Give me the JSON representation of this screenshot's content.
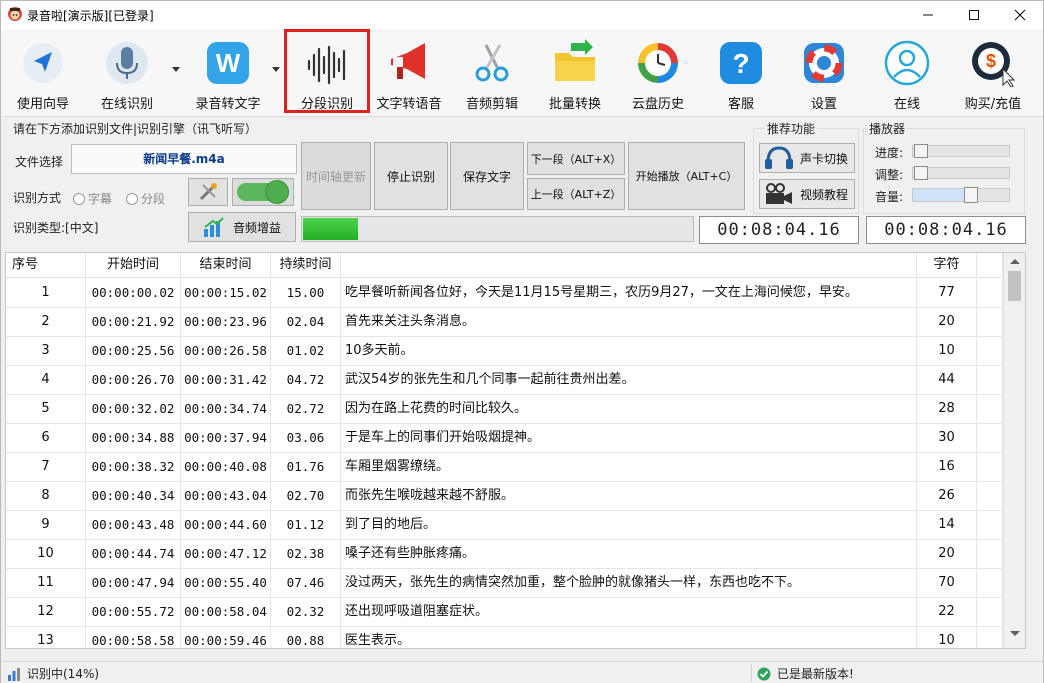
{
  "window": {
    "title": "录音啦[演示版][已登录]"
  },
  "toolbar": {
    "items": [
      {
        "label": "使用向导",
        "icon": "navigation-arrow-icon"
      },
      {
        "label": "在线识别",
        "icon": "microphone-icon"
      },
      {
        "label": "录音转文字",
        "icon": "w-logo-icon"
      },
      {
        "label": "分段识别",
        "icon": "waveform-icon"
      },
      {
        "label": "文字转语音",
        "icon": "megaphone-icon"
      },
      {
        "label": "音频剪辑",
        "icon": "scissors-icon"
      },
      {
        "label": "批量转换",
        "icon": "folder-convert-icon"
      },
      {
        "label": "云盘历史",
        "icon": "history-clock-icon"
      },
      {
        "label": "客服",
        "icon": "help-question-icon"
      },
      {
        "label": "设置",
        "icon": "lifebuoy-icon"
      },
      {
        "label": "在线",
        "icon": "user-online-icon"
      },
      {
        "label": "购买/充值",
        "icon": "dollar-coin-icon"
      }
    ]
  },
  "controls": {
    "group_title": "请在下方添加识别文件|识别引擎（讯飞听写）",
    "file_label": "文件选择",
    "file_name": "新闻早餐.m4a",
    "mode_label": "识别方式",
    "mode_option_subtitle": "字幕",
    "mode_option_segment": "分段",
    "type_label": "识别类型:[中文]",
    "audio_gain": "音频增益",
    "btn_update_timeline": "时间轴更新",
    "btn_stop": "停止识别",
    "btn_save": "保存文字",
    "btn_next": "下一段（ALT+X）",
    "btn_prev": "上一段（ALT+Z）",
    "btn_play": "开始播放（ALT+C）",
    "progress": 0.14,
    "time_current": "00:08:04.16",
    "time_total": "00:08:04.16"
  },
  "recommend": {
    "title": "推荐功能",
    "sound_card": "声卡切换",
    "video_tutorial": "视频教程"
  },
  "player": {
    "title": "播放器",
    "progress_label": "进度:",
    "adjust_label": "调整:",
    "volume_label": "音量:",
    "volume_level": 0.6
  },
  "table": {
    "headers": {
      "no": "序号",
      "start": "开始时间",
      "end": "结束时间",
      "duration": "持续时间",
      "text": "",
      "chars": "字符"
    },
    "rows": [
      {
        "no": "1",
        "start": "00:00:00.02",
        "end": "00:00:15.02",
        "duration": "15.00",
        "text": "吃早餐听新闻各位好，今天是11月15号星期三，农历9月27，一文在上海问候您，早安。",
        "chars": "77"
      },
      {
        "no": "2",
        "start": "00:00:21.92",
        "end": "00:00:23.96",
        "duration": "02.04",
        "text": "首先来关注头条消息。",
        "chars": "20"
      },
      {
        "no": "3",
        "start": "00:00:25.56",
        "end": "00:00:26.58",
        "duration": "01.02",
        "text": "10多天前。",
        "chars": "10"
      },
      {
        "no": "4",
        "start": "00:00:26.70",
        "end": "00:00:31.42",
        "duration": "04.72",
        "text": "武汉54岁的张先生和几个同事一起前往贵州出差。",
        "chars": "44"
      },
      {
        "no": "5",
        "start": "00:00:32.02",
        "end": "00:00:34.74",
        "duration": "02.72",
        "text": "因为在路上花费的时间比较久。",
        "chars": "28"
      },
      {
        "no": "6",
        "start": "00:00:34.88",
        "end": "00:00:37.94",
        "duration": "03.06",
        "text": "于是车上的同事们开始吸烟提神。",
        "chars": "30"
      },
      {
        "no": "7",
        "start": "00:00:38.32",
        "end": "00:00:40.08",
        "duration": "01.76",
        "text": "车厢里烟雾缭绕。",
        "chars": "16"
      },
      {
        "no": "8",
        "start": "00:00:40.34",
        "end": "00:00:43.04",
        "duration": "02.70",
        "text": "而张先生喉咙越来越不舒服。",
        "chars": "26"
      },
      {
        "no": "9",
        "start": "00:00:43.48",
        "end": "00:00:44.60",
        "duration": "01.12",
        "text": "到了目的地后。",
        "chars": "14"
      },
      {
        "no": "10",
        "start": "00:00:44.74",
        "end": "00:00:47.12",
        "duration": "02.38",
        "text": "嗓子还有些肿胀疼痛。",
        "chars": "20"
      },
      {
        "no": "11",
        "start": "00:00:47.94",
        "end": "00:00:55.40",
        "duration": "07.46",
        "text": "没过两天，张先生的病情突然加重，整个脸肿的就像猪头一样，东西也吃不下。",
        "chars": "70"
      },
      {
        "no": "12",
        "start": "00:00:55.72",
        "end": "00:00:58.04",
        "duration": "02.32",
        "text": "还出现呼吸道阻塞症状。",
        "chars": "22"
      },
      {
        "no": "13",
        "start": "00:00:58.58",
        "end": "00:00:59.46",
        "duration": "00.88",
        "text": "医生表示。",
        "chars": "10"
      }
    ]
  },
  "status": {
    "left": "识别中(14%)",
    "right": "已是最新版本!"
  }
}
